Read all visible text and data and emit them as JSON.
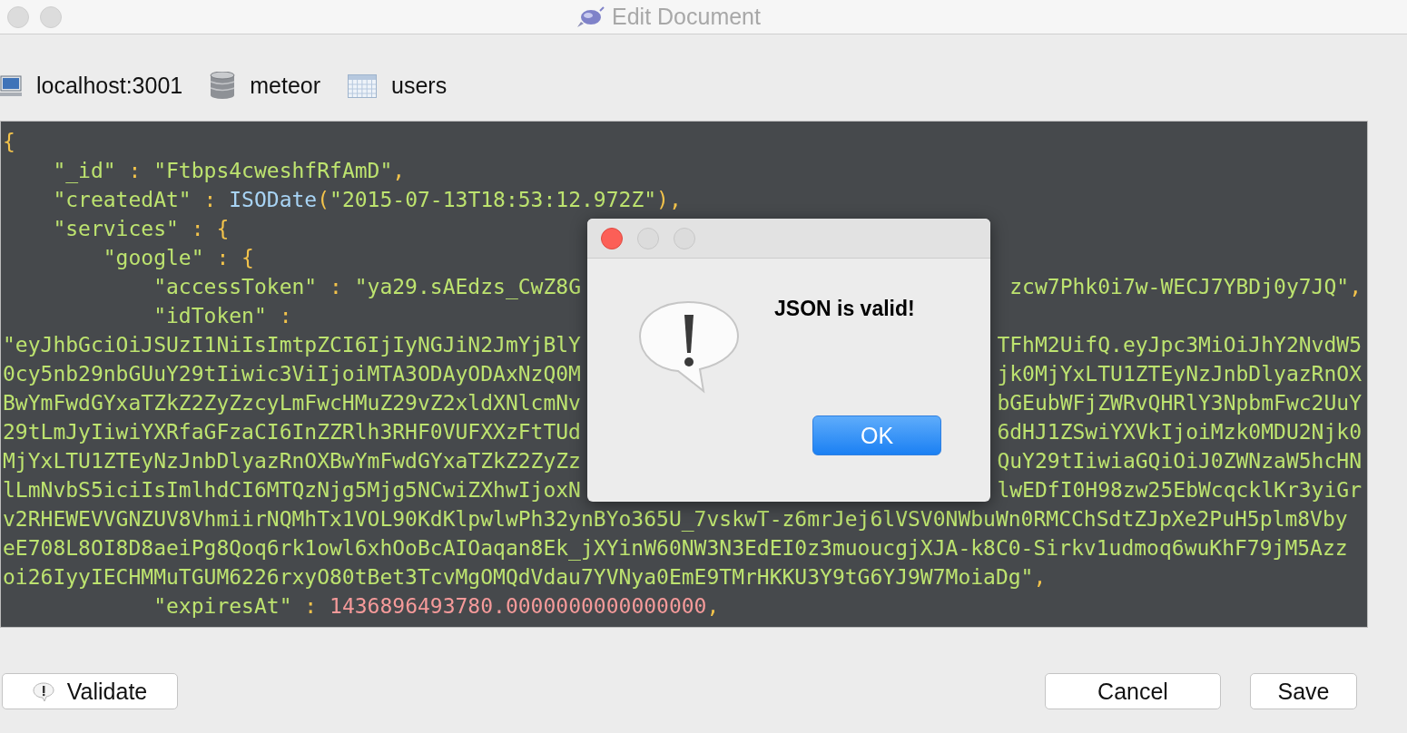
{
  "window": {
    "title": "Edit Document"
  },
  "breadcrumb": [
    {
      "kind": "host",
      "label": "localhost:3001"
    },
    {
      "kind": "database",
      "label": "meteor"
    },
    {
      "kind": "collection",
      "label": "users"
    }
  ],
  "editor": {
    "lines": [
      {
        "left": [
          {
            "kind": "punct",
            "text": "{"
          }
        ]
      },
      {
        "left": [
          {
            "kind": "key",
            "text": "    \"_id\""
          },
          {
            "kind": "punct",
            "text": " : "
          },
          {
            "kind": "string",
            "text": "\"Ftbps4cweshfRfAmD\""
          },
          {
            "kind": "punct",
            "text": ","
          }
        ]
      },
      {
        "left": [
          {
            "kind": "key",
            "text": "    \"createdAt\""
          },
          {
            "kind": "punct",
            "text": " : "
          },
          {
            "kind": "func",
            "text": "ISODate"
          },
          {
            "kind": "punct",
            "text": "("
          },
          {
            "kind": "string",
            "text": "\"2015-07-13T18:53:12.972Z\""
          },
          {
            "kind": "punct",
            "text": ")"
          },
          {
            "kind": "punct",
            "text": ","
          }
        ]
      },
      {
        "left": [
          {
            "kind": "key",
            "text": "    \"services\""
          },
          {
            "kind": "punct",
            "text": " : "
          },
          {
            "kind": "punct",
            "text": "{"
          }
        ]
      },
      {
        "left": [
          {
            "kind": "key",
            "text": "        \"google\""
          },
          {
            "kind": "punct",
            "text": " : "
          },
          {
            "kind": "punct",
            "text": "{"
          }
        ]
      },
      {
        "left": [
          {
            "kind": "key",
            "text": "            \"accessToken\""
          },
          {
            "kind": "punct",
            "text": " : "
          },
          {
            "kind": "string",
            "text": "\"ya29.sAEdzs_CwZ8G"
          }
        ],
        "right": [
          {
            "kind": "string",
            "text": "zcw7Phk0i7w-WECJ7YBDj0y7JQ\""
          },
          {
            "kind": "punct",
            "text": ","
          }
        ]
      },
      {
        "left": [
          {
            "kind": "key",
            "text": "            \"idToken\""
          },
          {
            "kind": "punct",
            "text": " :"
          }
        ]
      },
      {
        "left": [
          {
            "kind": "string",
            "text": "\"eyJhbGciOiJSUzI1NiIsImtpZCI6IjIyNGJiN2JmYjBlY"
          }
        ],
        "right": [
          {
            "kind": "string",
            "text": "TFhM2UifQ.eyJpc3MiOiJhY2NvdW5"
          }
        ]
      },
      {
        "left": [
          {
            "kind": "string",
            "text": "0cy5nb29nbGUuY29tIiwic3ViIjoiMTA3ODAyODAxNzQ0M"
          }
        ],
        "right": [
          {
            "kind": "string",
            "text": "jk0MjYxLTU1ZTEyNzJnbDlyazRnOX"
          }
        ]
      },
      {
        "left": [
          {
            "kind": "string",
            "text": "BwYmFwdGYxaTZkZ2ZyZzcyLmFwcHMuZ29vZ2xldXNlcmNv"
          }
        ],
        "right": [
          {
            "kind": "string",
            "text": "bGEubWFjZWRvQHRlY3NpbmFwc2UuY"
          }
        ]
      },
      {
        "left": [
          {
            "kind": "string",
            "text": "29tLmJyIiwiYXRfaGFzaCI6InZZRlh3RHF0VUFXXzFtTUd"
          }
        ],
        "right": [
          {
            "kind": "string",
            "text": "6dHJ1ZSwiYXVkIjoiMzk0MDU2Njk0"
          }
        ]
      },
      {
        "left": [
          {
            "kind": "string",
            "text": "MjYxLTU1ZTEyNzJnbDlyazRnOXBwYmFwdGYxaTZkZ2ZyZz"
          }
        ],
        "right": [
          {
            "kind": "string",
            "text": "QuY29tIiwiaGQiOiJ0ZWNzaW5hcHN"
          }
        ]
      },
      {
        "left": [
          {
            "kind": "string",
            "text": "lLmNvbS5iciIsImlhdCI6MTQzNjg5Mjg5NCwiZXhwIjoxN"
          }
        ],
        "right": [
          {
            "kind": "string",
            "text": "lwEDfI0H98zw25EbWcqcklKr3yiGr"
          }
        ]
      },
      {
        "left": [
          {
            "kind": "string",
            "text": "v2RHEWEVVGNZUV8VhmiirNQMhTx1VOL90KdKlpwlwPh32ynBYo365U_7vskwT-z6mrJej6lVSV0NWbuWn0RMCChSdtZJpXe2PuH5plm8Vby"
          }
        ]
      },
      {
        "left": [
          {
            "kind": "string",
            "text": "eE708L8OI8D8aeiPg8Qoq6rk1owl6xhOoBcAIOaqan8Ek_jXYinW60NW3N3EdEI0z3muoucgjXJA-k8C0-Sirkv1udmoq6wuKhF79jM5Azz"
          }
        ]
      },
      {
        "left": [
          {
            "kind": "string",
            "text": "oi26IyyIECHMMuTGUM6226rxyO80tBet3TcvMgOMQdVdau7YVNya0EmE9TMrHKKU3Y9tG6YJ9W7MoiaDg\""
          },
          {
            "kind": "punct",
            "text": ","
          }
        ]
      },
      {
        "left": [
          {
            "kind": "key",
            "text": "            \"expiresAt\""
          },
          {
            "kind": "punct",
            "text": " : "
          },
          {
            "kind": "number",
            "text": "1436896493780.0000000000000000"
          },
          {
            "kind": "punct",
            "text": ","
          }
        ]
      }
    ]
  },
  "dialog": {
    "message": "JSON is valid!",
    "button": "OK"
  },
  "buttons": [
    {
      "kind": "validate",
      "label": "Validate"
    },
    {
      "kind": "plain",
      "label": "Cancel"
    },
    {
      "kind": "plain",
      "label": "Save"
    }
  ]
}
